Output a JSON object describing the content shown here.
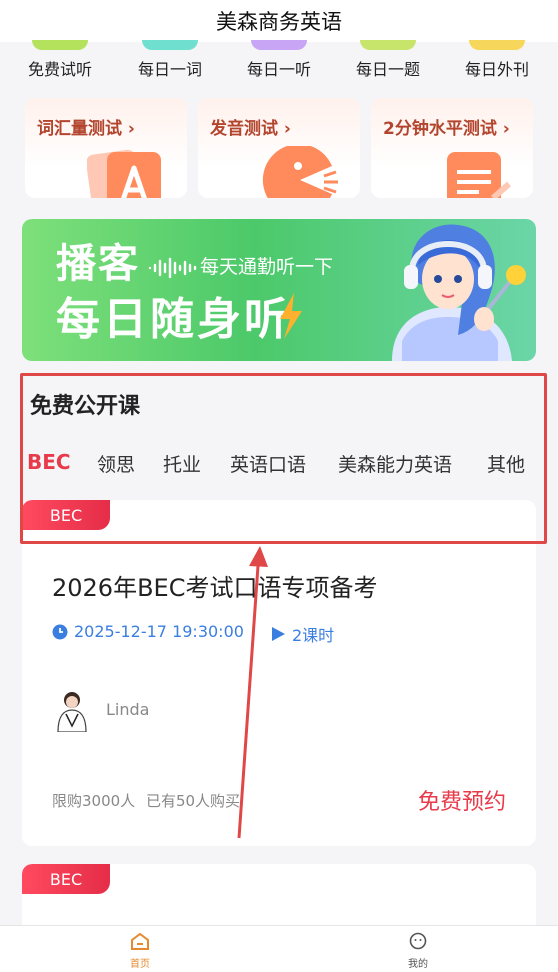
{
  "app_title": "美森商务英语",
  "quick_entries": [
    {
      "label": "免费试听",
      "color": "#b5e25c"
    },
    {
      "label": "每日一词",
      "color": "#6fe0d0"
    },
    {
      "label": "每日一听",
      "color": "#c8a6f5"
    },
    {
      "label": "每日一题",
      "color": "#c6e56a"
    },
    {
      "label": "每日外刊",
      "color": "#f6d75c"
    }
  ],
  "tests": [
    {
      "label": "词汇量测试",
      "icon": "letter-a-card-icon"
    },
    {
      "label": "发音测试",
      "icon": "pacman-mouth-icon"
    },
    {
      "label": "2分钟水平测试",
      "icon": "document-pen-icon"
    }
  ],
  "banner": {
    "line1": "播客",
    "line2": "每日随身听",
    "tagline": "每天通勤听一下"
  },
  "section": {
    "title": "免费公开课",
    "tabs": [
      "BEC",
      "领思",
      "托业",
      "英语口语",
      "美森能力英语",
      "其他"
    ],
    "active_tab": "BEC"
  },
  "courses": [
    {
      "badge": "BEC",
      "title": "2026年BEC考试口语专项备考",
      "datetime": "2025-12-17 19:30:00",
      "lessons": "2课时",
      "teacher": "Linda",
      "limit": "限购3000人",
      "purchased": "已有50人购买",
      "action": "免费预约"
    },
    {
      "badge": "BEC"
    }
  ],
  "tabbar": {
    "home": "首页",
    "mine": "我的"
  },
  "colors": {
    "accent": "#e83a4a",
    "info_blue": "#3a7fe0",
    "annotation": "#e04848"
  }
}
